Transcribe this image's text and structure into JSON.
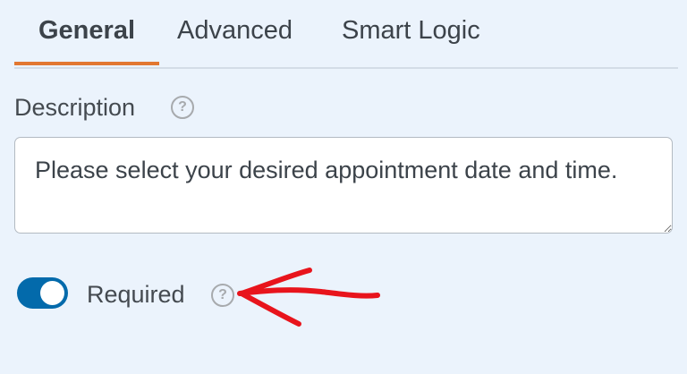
{
  "tabs": [
    {
      "label": "General",
      "active": true
    },
    {
      "label": "Advanced",
      "active": false
    },
    {
      "label": "Smart Logic",
      "active": false
    }
  ],
  "description": {
    "label": "Description",
    "help_icon": "question-circle-icon",
    "value": "Please select your desired appointment date and time."
  },
  "required": {
    "label": "Required",
    "enabled": true,
    "help_icon": "question-circle-icon"
  },
  "colors": {
    "background": "#ebf3fc",
    "active_tab_underline": "#e27730",
    "toggle_on": "#036aab",
    "annotation_arrow": "#e8141c"
  },
  "help_glyph": "?"
}
